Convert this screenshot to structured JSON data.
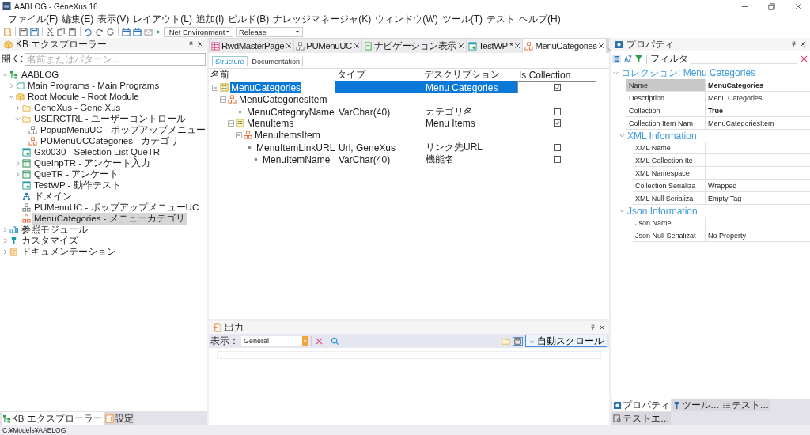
{
  "window": {
    "title": "AABLOG - GeneXus 16"
  },
  "menu": [
    "ファイル(F)",
    "編集(E)",
    "表示(V)",
    "レイアウト(L)",
    "追加(I)",
    "ビルド(B)",
    "ナレッジマネージャ(K)",
    "ウィンドウ(W)",
    "ツール(T)",
    "テスト",
    "ヘルプ(H)"
  ],
  "toolbar": {
    "environment": ".Net Environment",
    "configuration": "Release"
  },
  "explorer": {
    "title": "KB エクスプローラー",
    "search_label": "開く:",
    "search_placeholder": "名前またはパターン...",
    "tree": [
      {
        "label": "AABLOG",
        "kind": "kb",
        "expanded": true,
        "selected": false,
        "children": [
          {
            "label": "Main Programs - Main Programs",
            "kind": "programs",
            "expanded": false,
            "selected": false
          },
          {
            "label": "Root Module - Root Module",
            "kind": "module",
            "expanded": true,
            "selected": false,
            "children": [
              {
                "label": "GeneXus - Gene Xus",
                "kind": "folder",
                "expanded": false,
                "selected": false
              },
              {
                "label": "USERCTRL - ユーザーコントロール",
                "kind": "folder",
                "expanded": true,
                "selected": false,
                "children": [
                  {
                    "label": "PopupMenuUC - ポップアップメニュー",
                    "kind": "uc",
                    "selected": false
                  },
                  {
                    "label": "PUMenuUCCategories - カテゴリ",
                    "kind": "sdt",
                    "selected": false
                  }
                ]
              },
              {
                "label": "Gx0030 - Selection List QueTR",
                "kind": "webpanel",
                "selected": false
              },
              {
                "label": "QueInpTR - アンケート入力",
                "kind": "transaction",
                "expanded": false,
                "selected": false
              },
              {
                "label": "QueTR - アンケート",
                "kind": "transaction",
                "expanded": false,
                "selected": false
              },
              {
                "label": "TestWP - 動作テスト",
                "kind": "webpanel",
                "selected": false
              },
              {
                "label": "ドメイン",
                "kind": "domain",
                "selected": false
              },
              {
                "label": "PUMenuUC - ポップアップメニューUC",
                "kind": "uc",
                "selected": false
              },
              {
                "label": "MenuCategories - メニューカテゴリ",
                "kind": "sdt",
                "selected": true
              }
            ]
          }
        ]
      },
      {
        "label": "参照モジュール",
        "kind": "references",
        "expanded": false,
        "selected": false
      },
      {
        "label": "カスタマイズ",
        "kind": "customize",
        "expanded": false,
        "selected": false
      },
      {
        "label": "ドキュメンテーション",
        "kind": "docs",
        "expanded": false,
        "selected": false
      }
    ]
  },
  "editor_tabs": [
    {
      "label": "RwdMasterPage",
      "kind": "masterpage",
      "selected": false
    },
    {
      "label": "PUMenuUC",
      "kind": "uc",
      "selected": false
    },
    {
      "label": "ナビゲーション表示",
      "kind": "report",
      "selected": false
    },
    {
      "label": "TestWP *",
      "kind": "webpanel",
      "selected": false
    },
    {
      "label": "MenuCategories",
      "kind": "sdt",
      "selected": true
    }
  ],
  "sub_tabs": [
    {
      "label": "Structure",
      "selected": true
    },
    {
      "label": "Documentation",
      "selected": false
    }
  ],
  "structure": {
    "columns": [
      "名前",
      "タイプ",
      "デスクリプション",
      "Is Collection"
    ],
    "rows": [
      {
        "name": "MenuCategories",
        "kind": "collection",
        "description": "Menu Categories",
        "is_collection": true,
        "selected": true,
        "expanded": true,
        "children": [
          {
            "name": "MenuCategoriesItem",
            "kind": "item",
            "selected": false,
            "expanded": true,
            "children": [
              {
                "name": "MenuCategoryName",
                "kind": "attribute",
                "type": "VarChar(40)",
                "description": "カテゴリ名",
                "is_collection": false,
                "selected": false
              },
              {
                "name": "MenuItems",
                "kind": "collection",
                "description": "Menu Items",
                "is_collection": true,
                "selected": false,
                "expanded": true,
                "children": [
                  {
                    "name": "MenuItemsItem",
                    "kind": "item",
                    "selected": false,
                    "expanded": true,
                    "children": [
                      {
                        "name": "MenuItemLinkURL",
                        "kind": "attribute",
                        "type": "Url, GeneXus",
                        "description": "リンク先URL",
                        "is_collection": false,
                        "selected": false
                      },
                      {
                        "name": "MenuItemName",
                        "kind": "attribute",
                        "type": "VarChar(40)",
                        "description": "機能名",
                        "is_collection": false,
                        "selected": false
                      }
                    ]
                  }
                ]
              }
            ]
          }
        ]
      }
    ]
  },
  "output": {
    "title": "出力",
    "show_label": "表示：",
    "source": "General",
    "autoscroll_label": "自動スクロール"
  },
  "properties": {
    "title": "プロパティ",
    "filter_label": "フィルタ",
    "sections": [
      {
        "title": "コレクション: Menu Categories",
        "expanded": true,
        "rows": [
          {
            "name": "Name",
            "value": "MenuCategories",
            "selected": true,
            "modified": true
          },
          {
            "name": "Description",
            "value": "Menu Categories",
            "selected": false,
            "modified": false
          },
          {
            "name": "Collection",
            "value": "True",
            "selected": false,
            "modified": true
          },
          {
            "name": "Collection Item Nam",
            "value": "MenuCategoriesItem",
            "selected": false,
            "modified": false
          }
        ],
        "children": [
          {
            "title": "XML Information",
            "expanded": true,
            "rows": [
              {
                "name": "XML Name",
                "selected": false,
                "modified": false
              },
              {
                "name": "XML Collection Ite",
                "selected": false,
                "modified": false
              },
              {
                "name": "XML Namespace",
                "selected": false,
                "modified": false
              },
              {
                "name": "Collection Serializa",
                "value": "Wrapped",
                "selected": false,
                "modified": false
              },
              {
                "name": "XML Null Serializa",
                "value": "Empty Tag",
                "selected": false,
                "modified": false
              }
            ]
          },
          {
            "title": "Json Information",
            "expanded": true,
            "rows": [
              {
                "name": "Json Name",
                "selected": false,
                "modified": false
              },
              {
                "name": "Json Null Serializat",
                "value": "No Property",
                "selected": false,
                "modified": false
              }
            ]
          }
        ]
      }
    ]
  },
  "left_tabs": [
    {
      "label": "KB エクスプローラー",
      "kind": "kb",
      "selected": true
    },
    {
      "label": "設定",
      "kind": "settings",
      "selected": false
    }
  ],
  "right_tabs": [
    {
      "label": "プロパティ",
      "kind": "properties",
      "selected": true
    },
    {
      "label": "ツール…",
      "kind": "tools",
      "selected": false
    },
    {
      "label": "テスト…",
      "kind": "tests",
      "selected": false
    },
    {
      "label": "テストエ…",
      "kind": "testexplorer",
      "selected": false
    }
  ],
  "status_bar": {
    "path": "C:¥Models¥AABLOG"
  }
}
